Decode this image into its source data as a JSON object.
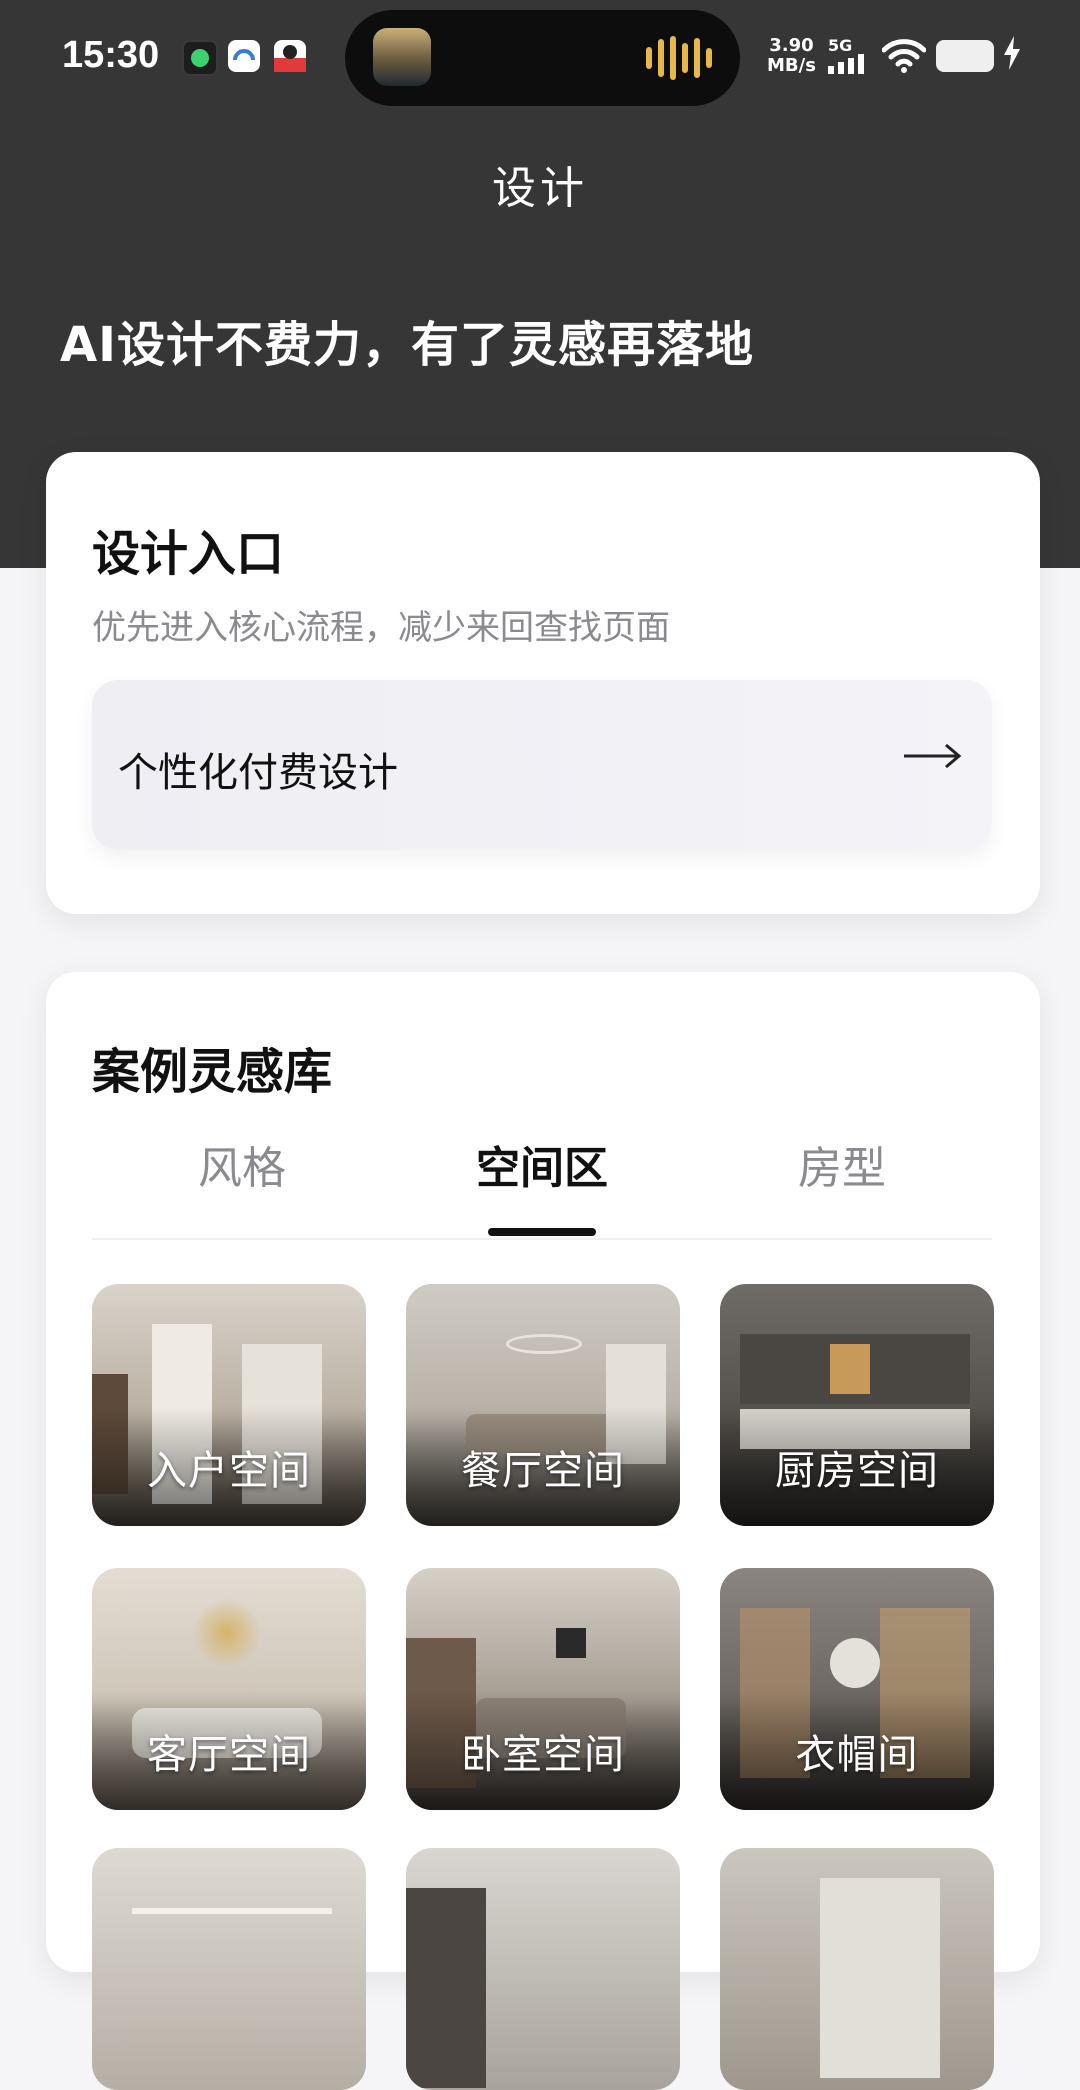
{
  "status_bar": {
    "time": "15:30",
    "network_speed_value": "3.90",
    "network_speed_unit": "MB/s",
    "network_type": "5G",
    "icons": [
      "app-notification-icon",
      "app-notification-icon",
      "app-notification-icon",
      "signal-icon",
      "wifi-icon",
      "battery-icon",
      "charging-icon"
    ]
  },
  "header": {
    "title": "设计",
    "slogan": "AI设计不费力，有了灵感再落地"
  },
  "entry_card": {
    "title": "设计入口",
    "subtitle": "优先进入核心流程，减少来回查找页面",
    "button_label": "个性化付费设计",
    "button_icon": "arrow-right-icon"
  },
  "cases_card": {
    "title": "案例灵感库",
    "tabs": [
      {
        "label": "风格",
        "active": false
      },
      {
        "label": "空间区",
        "active": true
      },
      {
        "label": "房型",
        "active": false
      }
    ],
    "tiles": [
      {
        "label": "入户空间"
      },
      {
        "label": "餐厅空间"
      },
      {
        "label": "厨房空间"
      },
      {
        "label": "客厅空间"
      },
      {
        "label": "卧室空间"
      },
      {
        "label": "衣帽间"
      },
      {
        "label": ""
      },
      {
        "label": ""
      },
      {
        "label": ""
      }
    ]
  },
  "colors": {
    "header_bg": "#363636",
    "page_bg": "#f5f5f7",
    "card_bg": "#ffffff",
    "accent_wave": "#e6b84a"
  }
}
